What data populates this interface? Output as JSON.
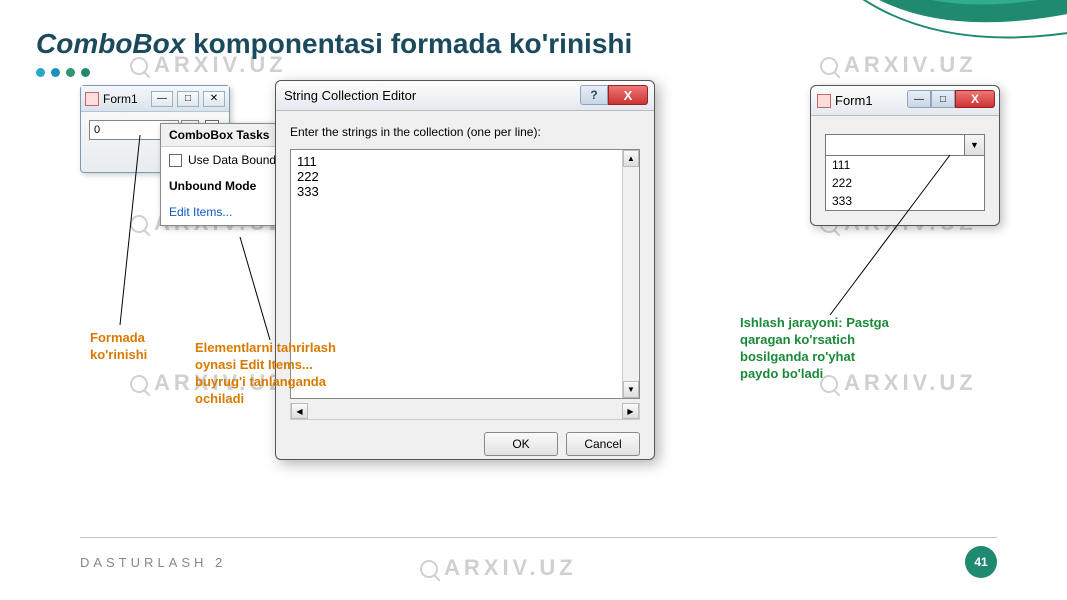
{
  "title": {
    "italic_part": "ComboBox",
    "rest": " komponentasi formada ko'rinishi"
  },
  "dots": [
    "#2aa6c9",
    "#1892bb",
    "#2f9471",
    "#1f8a70"
  ],
  "watermark_text": "ARXIV.UZ",
  "form1_left": {
    "title": "Form1",
    "combo_value": "0"
  },
  "tasks_popup": {
    "header": "ComboBox Tasks",
    "use_databound": "Use Data Bound Items",
    "mode": "Unbound Mode",
    "edit_items": "Edit Items..."
  },
  "sce_dialog": {
    "title": "String Collection Editor",
    "prompt": "Enter the strings in the collection (one per line):",
    "lines": "111\n222\n333",
    "ok": "OK",
    "cancel": "Cancel"
  },
  "form1_right": {
    "title": "Form1",
    "items": [
      "111",
      "222",
      "333"
    ]
  },
  "annotations": {
    "formada": "Formada ko'rinishi",
    "elementlarni": "Elementlarni tahrirlash oynasi Edit Items... buyrug'i tanlanganda ochiladi",
    "ishlash": "Ishlash jarayoni: Pastga qaragan ko'rsatich bosilganda ro'yhat paydo bo'ladi"
  },
  "footer": {
    "label": "DASTURLASH 2",
    "page": "41"
  }
}
